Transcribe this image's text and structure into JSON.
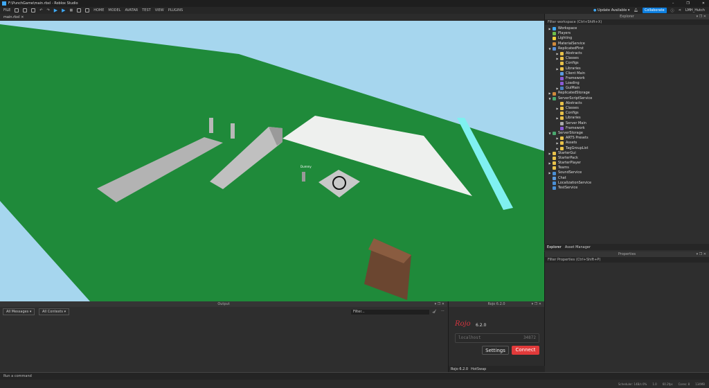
{
  "window": {
    "title": "F:\\PunchGame\\main.rbxl - Roblox Studio",
    "min": "–",
    "max": "❐",
    "close": "✕"
  },
  "menubar": {
    "file": "FILE",
    "tabs": [
      "HOME",
      "MODEL",
      "AVATAR",
      "TEST",
      "VIEW",
      "PLUGINS"
    ],
    "update": "Update Available",
    "collaborate": "Collaborate",
    "user": "LMH_Hutch"
  },
  "doc_tab": {
    "label": "main.rbxl",
    "close": "×"
  },
  "viewport": {
    "dummy_label": "Dummy"
  },
  "explorer": {
    "title": "Explorer",
    "filter": "Filter workspace (Ctrl+Shift+X)",
    "items": [
      {
        "label": "Workspace",
        "depth": 0,
        "arrow": "▶",
        "color": "#3fa9f5"
      },
      {
        "label": "Players",
        "depth": 0,
        "arrow": "",
        "color": "#6fbf4a"
      },
      {
        "label": "Lighting",
        "depth": 0,
        "arrow": "",
        "color": "#f2d13c"
      },
      {
        "label": "MaterialService",
        "depth": 0,
        "arrow": "",
        "color": "#d08a3c"
      },
      {
        "label": "ReplicatedFirst",
        "depth": 0,
        "arrow": "▼",
        "color": "#5a8fd6"
      },
      {
        "label": "Abstracts",
        "depth": 1,
        "arrow": "▶",
        "color": "#e8c14a"
      },
      {
        "label": "Classes",
        "depth": 1,
        "arrow": "▶",
        "color": "#e8c14a"
      },
      {
        "label": "Configs",
        "depth": 1,
        "arrow": "",
        "color": "#e8c14a"
      },
      {
        "label": "Libraries",
        "depth": 1,
        "arrow": "▶",
        "color": "#e8c14a"
      },
      {
        "label": "Client Main",
        "depth": 1,
        "arrow": "",
        "color": "#5b9be0"
      },
      {
        "label": "Framework",
        "depth": 1,
        "arrow": "",
        "color": "#8a5bd6"
      },
      {
        "label": "Loading",
        "depth": 1,
        "arrow": "",
        "color": "#8a5bd6"
      },
      {
        "label": "GuiMain",
        "depth": 1,
        "arrow": "▶",
        "color": "#4a7fc0"
      },
      {
        "label": "ReplicatedStorage",
        "depth": 0,
        "arrow": "▶",
        "color": "#d08a3c"
      },
      {
        "label": "ServerScriptService",
        "depth": 0,
        "arrow": "▼",
        "color": "#4aa86f"
      },
      {
        "label": "Abstracts",
        "depth": 1,
        "arrow": "",
        "color": "#e8c14a"
      },
      {
        "label": "Classes",
        "depth": 1,
        "arrow": "▶",
        "color": "#e8c14a"
      },
      {
        "label": "Configs",
        "depth": 1,
        "arrow": "",
        "color": "#e8c14a"
      },
      {
        "label": "Libraries",
        "depth": 1,
        "arrow": "▶",
        "color": "#e8c14a"
      },
      {
        "label": "Server Main",
        "depth": 1,
        "arrow": "",
        "color": "#aaaaaa"
      },
      {
        "label": "Framework",
        "depth": 1,
        "arrow": "",
        "color": "#8a5bd6"
      },
      {
        "label": "ServerStorage",
        "depth": 0,
        "arrow": "▼",
        "color": "#4aa86f"
      },
      {
        "label": "ARTS Presets",
        "depth": 1,
        "arrow": "▶",
        "color": "#e8c14a"
      },
      {
        "label": "Assets",
        "depth": 1,
        "arrow": "▶",
        "color": "#e8c14a"
      },
      {
        "label": "TagGroupList",
        "depth": 1,
        "arrow": "▶",
        "color": "#e8c14a"
      },
      {
        "label": "StarterGui",
        "depth": 0,
        "arrow": "▶",
        "color": "#e8c14a"
      },
      {
        "label": "StarterPack",
        "depth": 0,
        "arrow": "",
        "color": "#e8c14a"
      },
      {
        "label": "StarterPlayer",
        "depth": 0,
        "arrow": "▶",
        "color": "#e8c14a"
      },
      {
        "label": "Teams",
        "depth": 0,
        "arrow": "",
        "color": "#e8c14a"
      },
      {
        "label": "SoundService",
        "depth": 0,
        "arrow": "▶",
        "color": "#4a8fd6"
      },
      {
        "label": "Chat",
        "depth": 0,
        "arrow": "",
        "color": "#5b9be0"
      },
      {
        "label": "LocalizationService",
        "depth": 0,
        "arrow": "",
        "color": "#4a8fd6"
      },
      {
        "label": "TestService",
        "depth": 0,
        "arrow": "",
        "color": "#4a8fd6"
      }
    ],
    "tabs": [
      "Explorer",
      "Asset Manager"
    ]
  },
  "properties": {
    "title": "Properties",
    "filter": "Filter Properties (Ctrl+Shift+P)"
  },
  "output": {
    "title": "Output",
    "messages_dd": "All Messages",
    "contexts_dd": "All Contexts",
    "filter": "Filter..."
  },
  "rojo": {
    "title": "Rojo 6.2.0",
    "logo": "Rojo",
    "version": "6.2.0",
    "host": "localhost",
    "port": "34872",
    "settings": "Settings",
    "connect": "Connect",
    "tabs": [
      "Rojo 6.2.0",
      "HotSwap"
    ]
  },
  "command": {
    "placeholder": "Run a command"
  },
  "status": {
    "scheduler": "Scheduler: 14B/s 0%",
    "v": "1.0",
    "fps": "60.2fps",
    "cores": "Cores: 8",
    "mem": "134MB"
  }
}
